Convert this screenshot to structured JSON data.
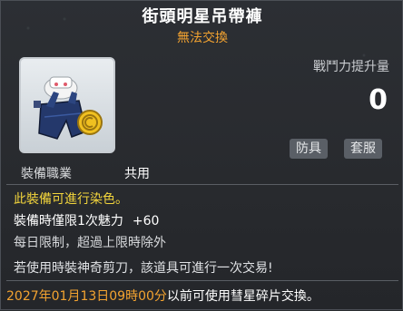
{
  "item": {
    "name": "街頭明星吊帶褲",
    "trade_status": "無法交換"
  },
  "combat_power": {
    "label": "戰鬥力提升量",
    "value": "0"
  },
  "tags": [
    "防具",
    "套服"
  ],
  "job": {
    "label": "裝備職業",
    "value": "共用"
  },
  "descriptions": {
    "dye": "此裝備可進行染色。",
    "time_limit_label": "裝備時僅限1次魅力",
    "time_limit_bonus": "+60",
    "daily_limit": "每日限制，超過上限時除外",
    "scissors_note": "若使用時裝神奇剪刀，該道具可進行一次交易!"
  },
  "exchange_notice": {
    "date": "2027年01月13日09時00分",
    "text": "以前可使用彗星碎片交換。"
  },
  "colors": {
    "title": "#ffffff",
    "subtitle": "#f3a330",
    "dye_text": "#f3d53c",
    "date": "#f3a330"
  }
}
